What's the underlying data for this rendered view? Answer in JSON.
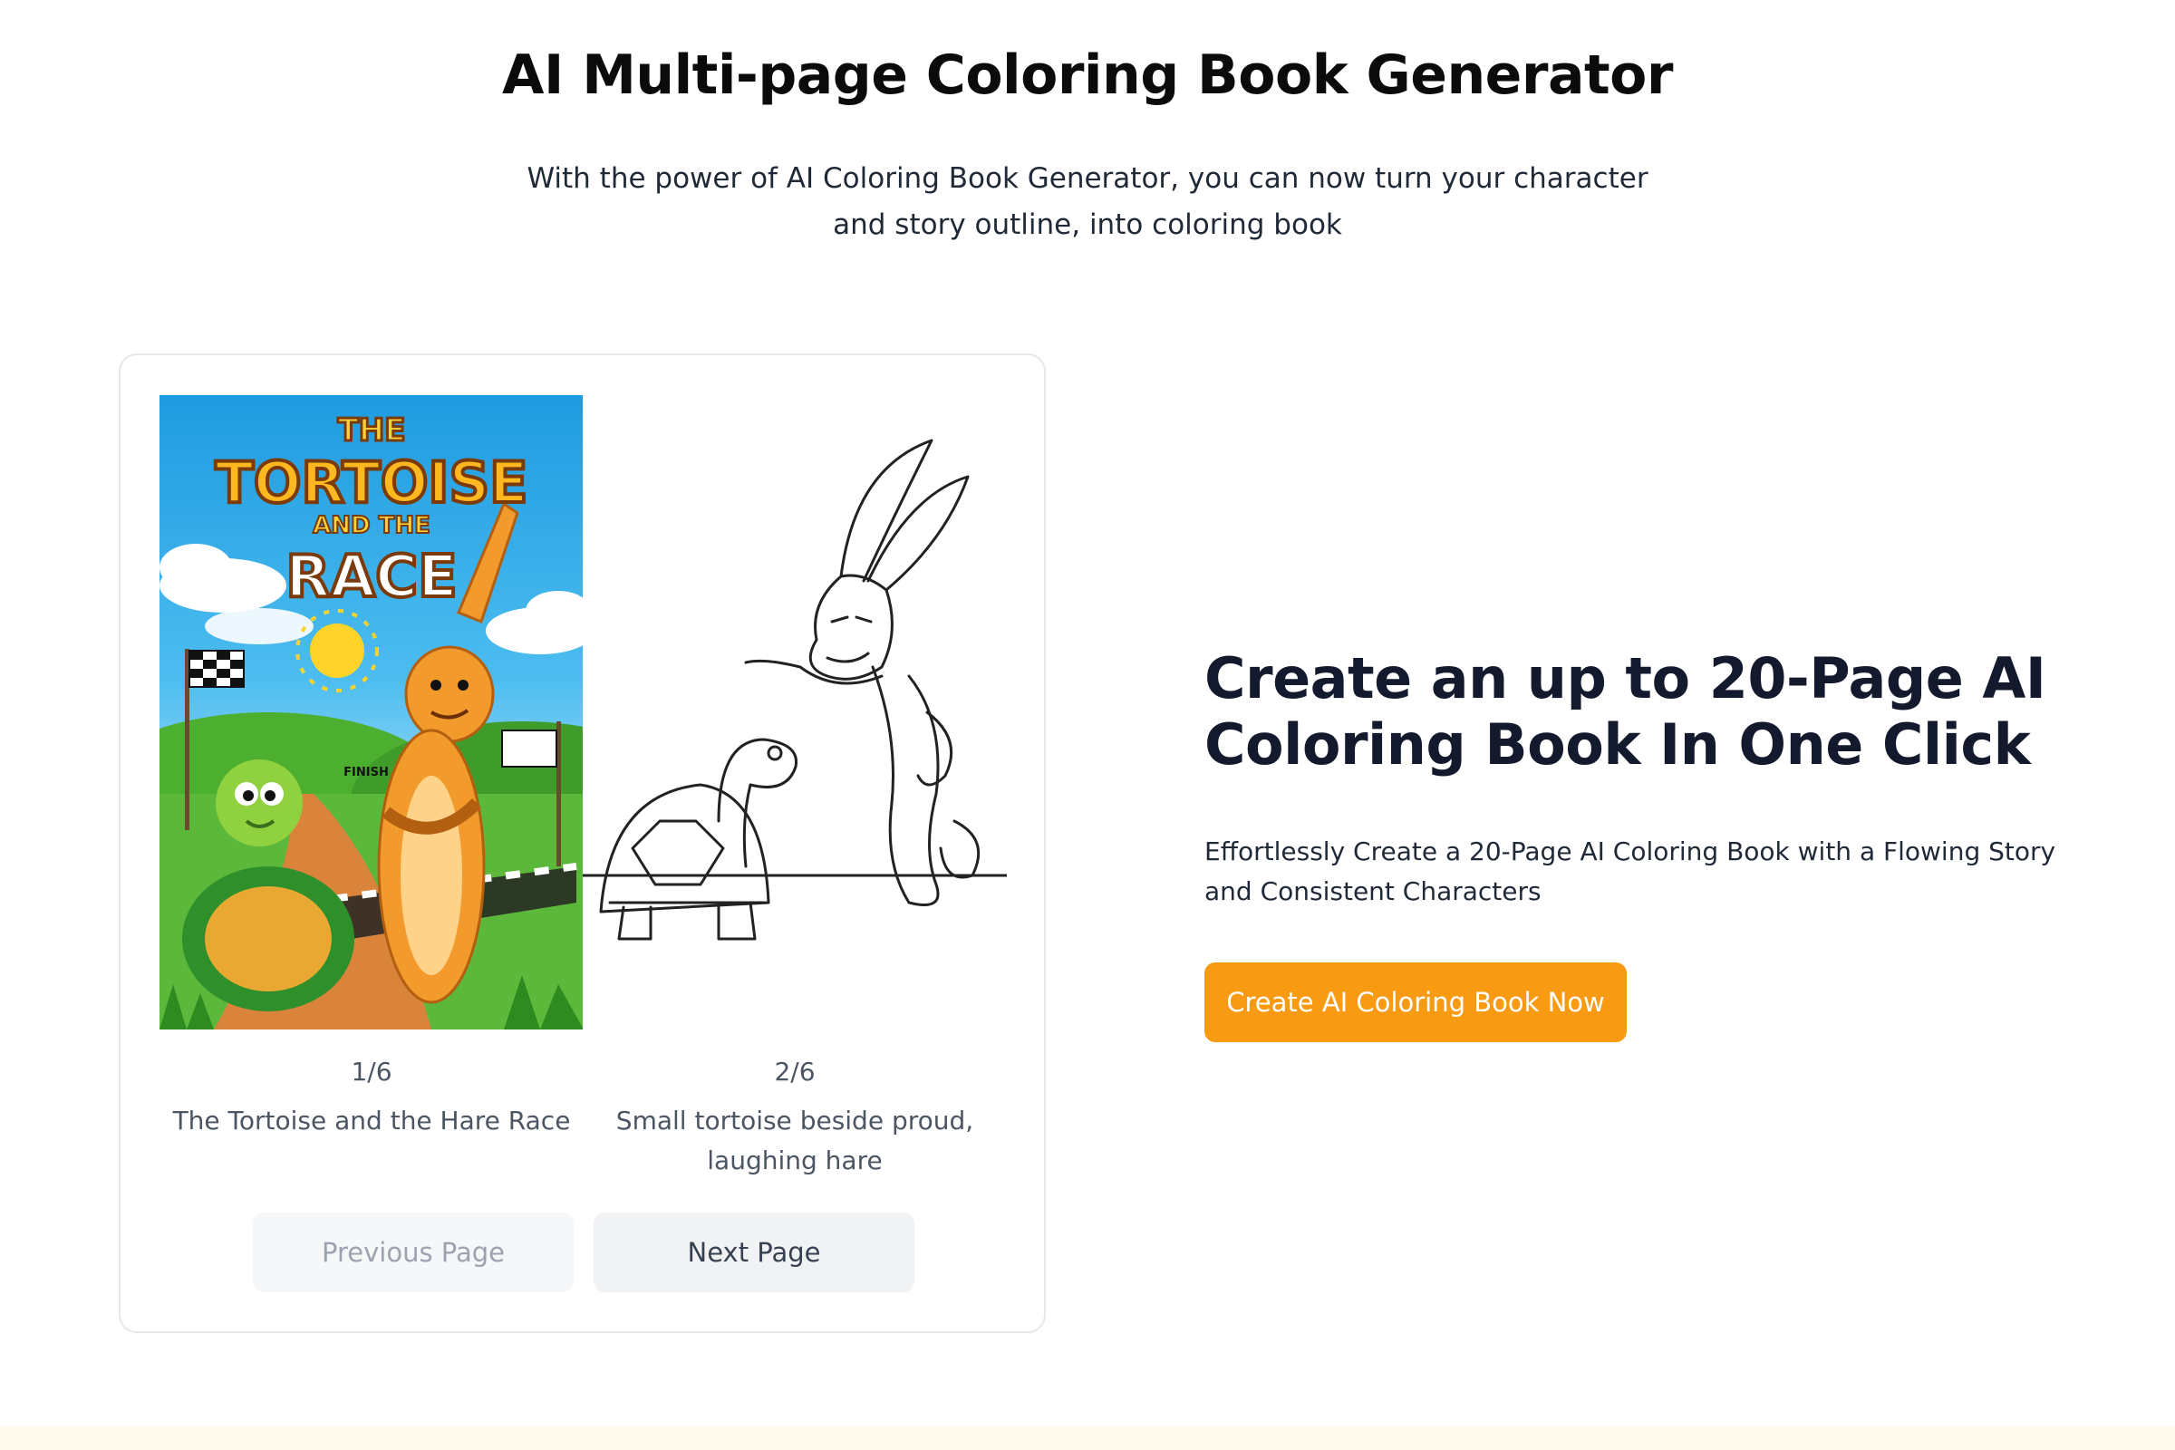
{
  "header": {
    "title": "AI Multi-page Coloring Book Generator",
    "subtitle": "With the power of AI Coloring Book Generator, you can now turn your character and story outline, into coloring book"
  },
  "preview": {
    "pages": [
      {
        "counter": "1/6",
        "caption": "The Tortoise and the Hare Race",
        "cover_text": {
          "line1": "THE",
          "line2": "TORTOISE",
          "line3": "AND THE",
          "line4": "RACE",
          "sign": "FINISH"
        }
      },
      {
        "counter": "2/6",
        "caption": "Small tortoise beside proud, laughing hare"
      }
    ],
    "prev_label": "Previous Page",
    "next_label": "Next Page"
  },
  "promo": {
    "heading": "Create an up to 20-Page AI Coloring Book In One Click",
    "description": "Effortlessly Create a 20-Page AI Coloring Book with a Flowing Story and Consistent Characters",
    "cta_label": "Create AI Coloring Book Now"
  },
  "colors": {
    "cta": "#f89a12",
    "heading": "#141a2e",
    "footer_band": "#fef9ec"
  }
}
